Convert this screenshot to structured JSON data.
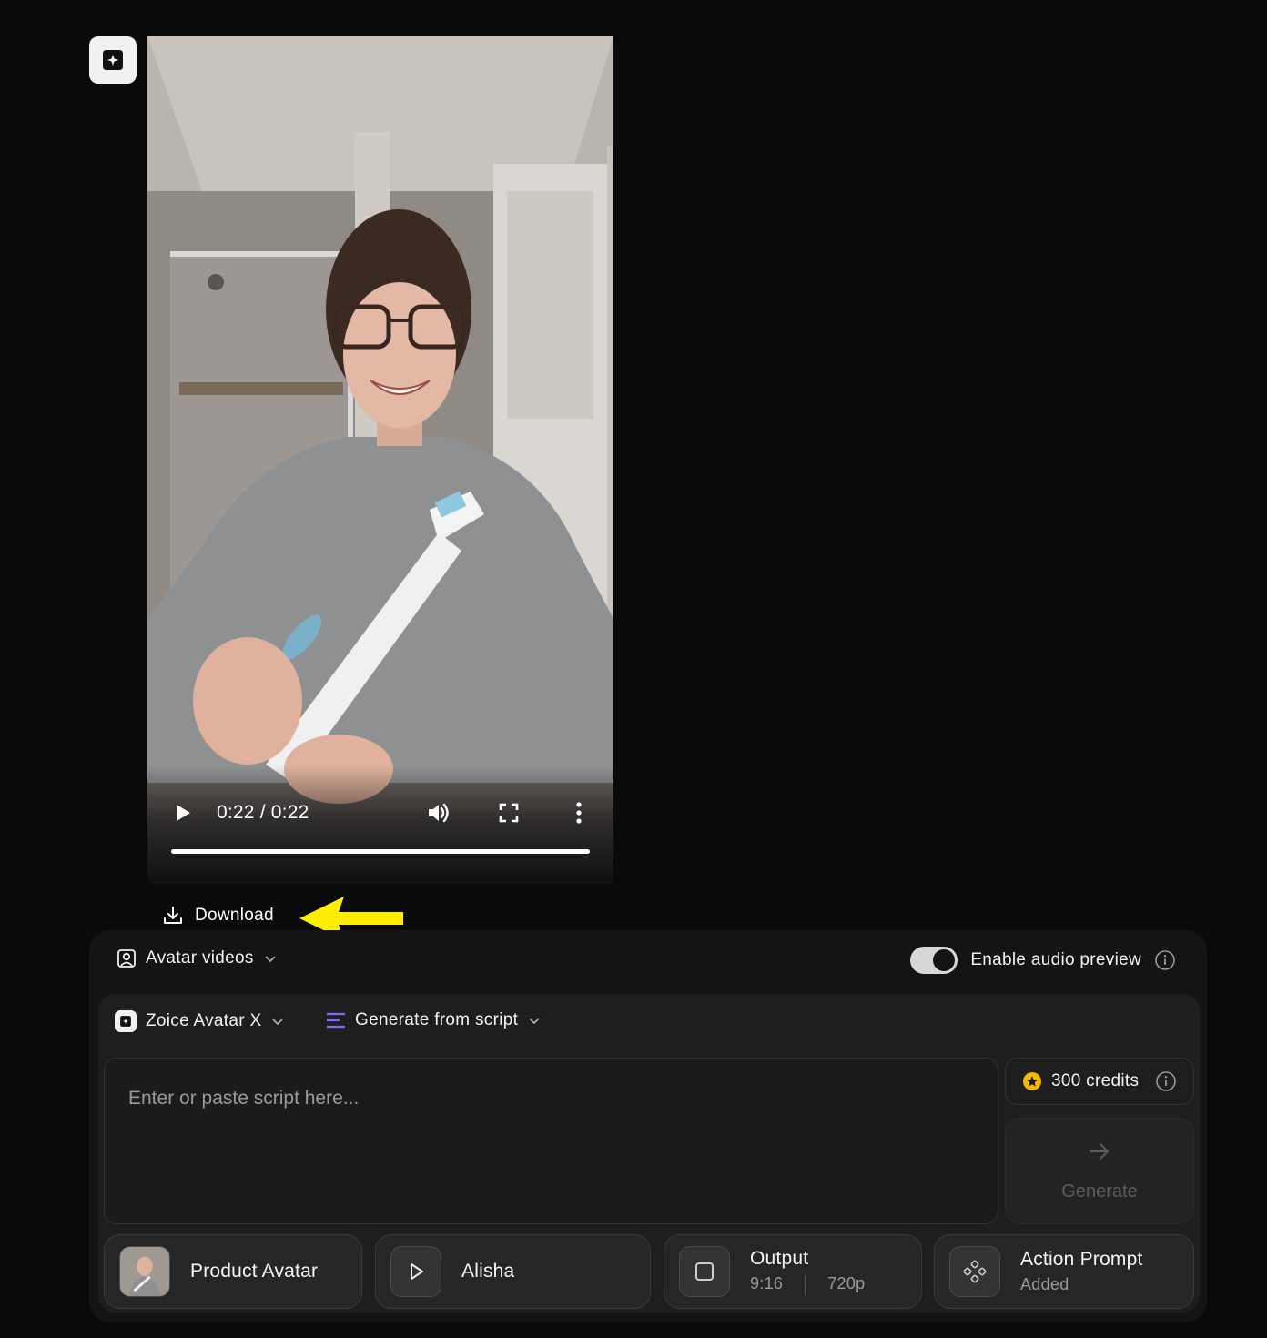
{
  "app": {
    "logo_icon": "zoice-logo-icon"
  },
  "video": {
    "time_label": "0:22 / 0:22",
    "progress": 1.0,
    "controls": [
      "play-icon",
      "volume-icon",
      "fullscreen-icon",
      "more-vertical-icon"
    ]
  },
  "download": {
    "label": "Download",
    "icon": "download-icon"
  },
  "annotation": {
    "icon": "yellow-arrow-icon",
    "color": "#ffee00"
  },
  "panel": {
    "category_label": "Avatar videos",
    "audio_preview_label": "Enable audio preview",
    "audio_preview_enabled": true
  },
  "composer": {
    "model_label": "Zoice Avatar X",
    "mode_label": "Generate from script",
    "script_placeholder": "Enter or paste script here...",
    "script_value": "",
    "credits_label": "300 credits",
    "generate_label": "Generate",
    "accent_color": "#7b6cff",
    "credits_color": "#f5b800"
  },
  "chips": {
    "avatar": {
      "title": "Product Avatar"
    },
    "voice": {
      "title": "Alisha"
    },
    "output": {
      "title": "Output",
      "ratio": "9:16",
      "resolution": "720p"
    },
    "action": {
      "title": "Action Prompt",
      "status": "Added"
    }
  }
}
